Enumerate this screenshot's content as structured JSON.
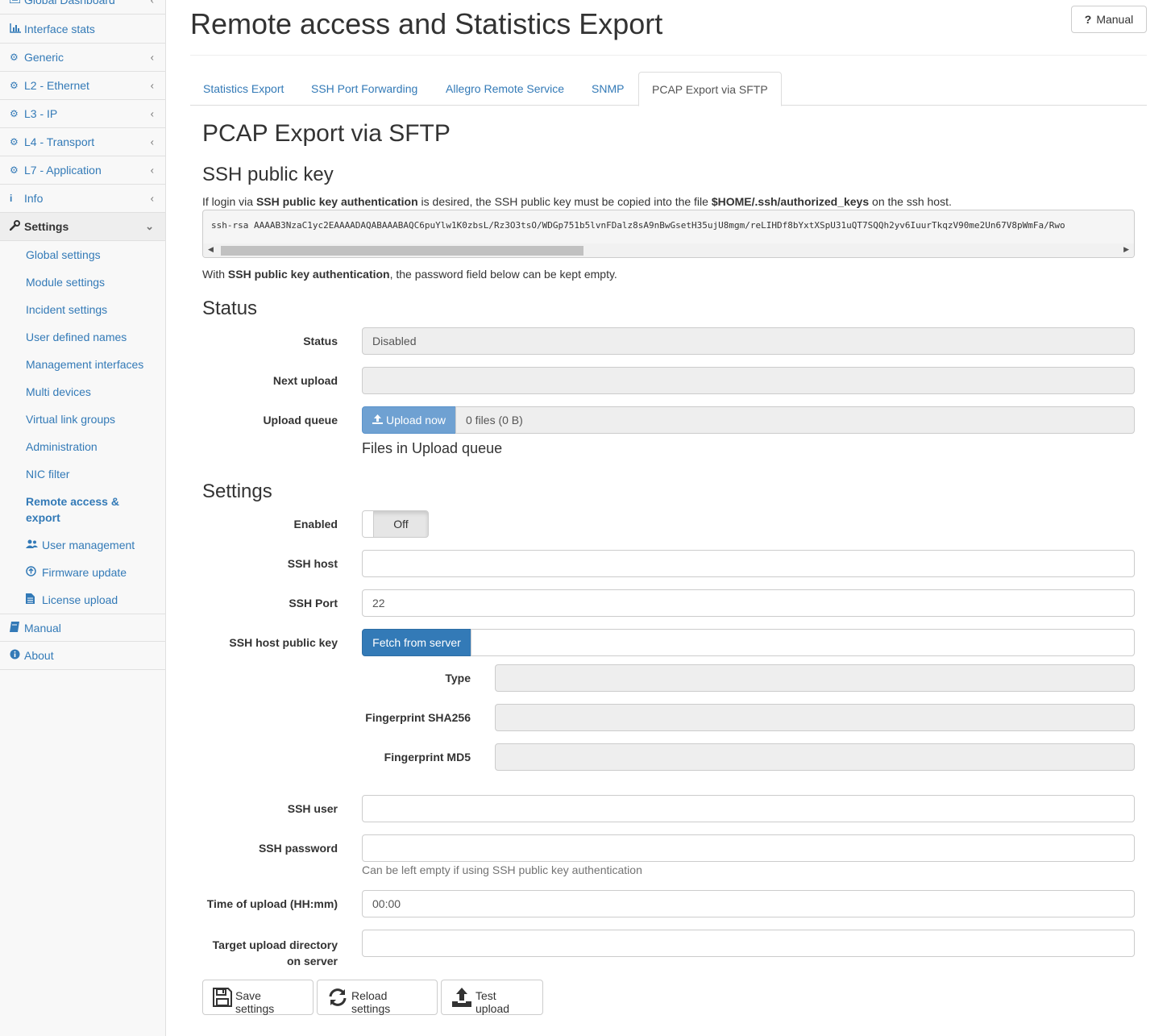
{
  "sidebar": {
    "items": [
      {
        "label": "Global Dashboard",
        "icon": "dashboard-icon"
      },
      {
        "label": "Interface stats",
        "icon": "bar-chart-icon"
      },
      {
        "label": "Generic",
        "icon": "gear-icon"
      },
      {
        "label": "L2 - Ethernet",
        "icon": "gear-icon"
      },
      {
        "label": "L3 - IP",
        "icon": "gear-icon"
      },
      {
        "label": "L4 - Transport",
        "icon": "gear-icon"
      },
      {
        "label": "L7 - Application",
        "icon": "gear-icon"
      },
      {
        "label": "Info",
        "icon": "info-icon"
      },
      {
        "label": "Settings",
        "icon": "wrench-icon"
      }
    ],
    "settings_sub": [
      "Global settings",
      "Module settings",
      "Incident settings",
      "User defined names",
      "Management interfaces",
      "Multi devices",
      "Virtual link groups",
      "Administration",
      "NIC filter",
      "Remote access &",
      "export",
      "User management",
      "Firmware update",
      "License upload"
    ],
    "bottom": [
      {
        "label": "Manual",
        "icon": "book-icon"
      },
      {
        "label": "About",
        "icon": "info-circle-icon"
      }
    ]
  },
  "header": {
    "title": "Remote access and Statistics Export",
    "manual_label": "Manual",
    "manual_icon": "question-icon"
  },
  "tabs": [
    "Statistics Export",
    "SSH Port Forwarding",
    "Allegro Remote Service",
    "SNMP",
    "PCAP Export via SFTP"
  ],
  "content": {
    "heading": "PCAP Export via SFTP",
    "ssh_key": {
      "heading": "SSH public key",
      "intro_1": "If login via ",
      "intro_bold_1": "SSH public key authentication",
      "intro_2": " is desired, the SSH public key must be copied into the file ",
      "intro_bold_2": "$HOME/.ssh/authorized_keys",
      "intro_3": " on the ssh host.",
      "key": "ssh-rsa AAAAB3NzaC1yc2EAAAADAQABAAABAQC6puYlw1K0zbsL/Rz3O3tsO/WDGp751b5lvnFDalz8sA9nBwGsetH35ujU8mgm/reLIHDf8bYxtXSpU31uQT7SQQh2yv6IuurTkqzV90me2Un67V8pWmFa/Rwo",
      "note_1": "With ",
      "note_bold": "SSH public key authentication",
      "note_2": ", the password field below can be kept empty."
    },
    "status": {
      "heading": "Status",
      "status_label": "Status",
      "status_value": "Disabled",
      "next_upload_label": "Next upload",
      "next_upload_value": "",
      "queue_label": "Upload queue",
      "upload_now": "Upload now",
      "queue_value": "0 files (0 B)",
      "files_in_queue": "Files in Upload queue"
    },
    "settings": {
      "heading": "Settings",
      "enabled_label": "Enabled",
      "enabled_value": "Off",
      "ssh_host_label": "SSH host",
      "ssh_host_value": "",
      "ssh_port_label": "SSH Port",
      "ssh_port_value": "22",
      "host_key_label": "SSH host public key",
      "fetch_label": "Fetch from server",
      "type_label": "Type",
      "sha256_label": "Fingerprint SHA256",
      "md5_label": "Fingerprint MD5",
      "ssh_user_label": "SSH user",
      "ssh_user_value": "",
      "ssh_password_label": "SSH password",
      "ssh_password_value": "",
      "password_help": "Can be left empty if using SSH public key authentication",
      "time_label": "Time of upload (HH:mm)",
      "time_value": "00:00",
      "target_dir_label_1": "Target upload directory",
      "target_dir_label_2": "on server",
      "target_dir_value": ""
    },
    "actions": {
      "save": "Save settings",
      "reload": "Reload settings",
      "test": "Test upload"
    }
  }
}
